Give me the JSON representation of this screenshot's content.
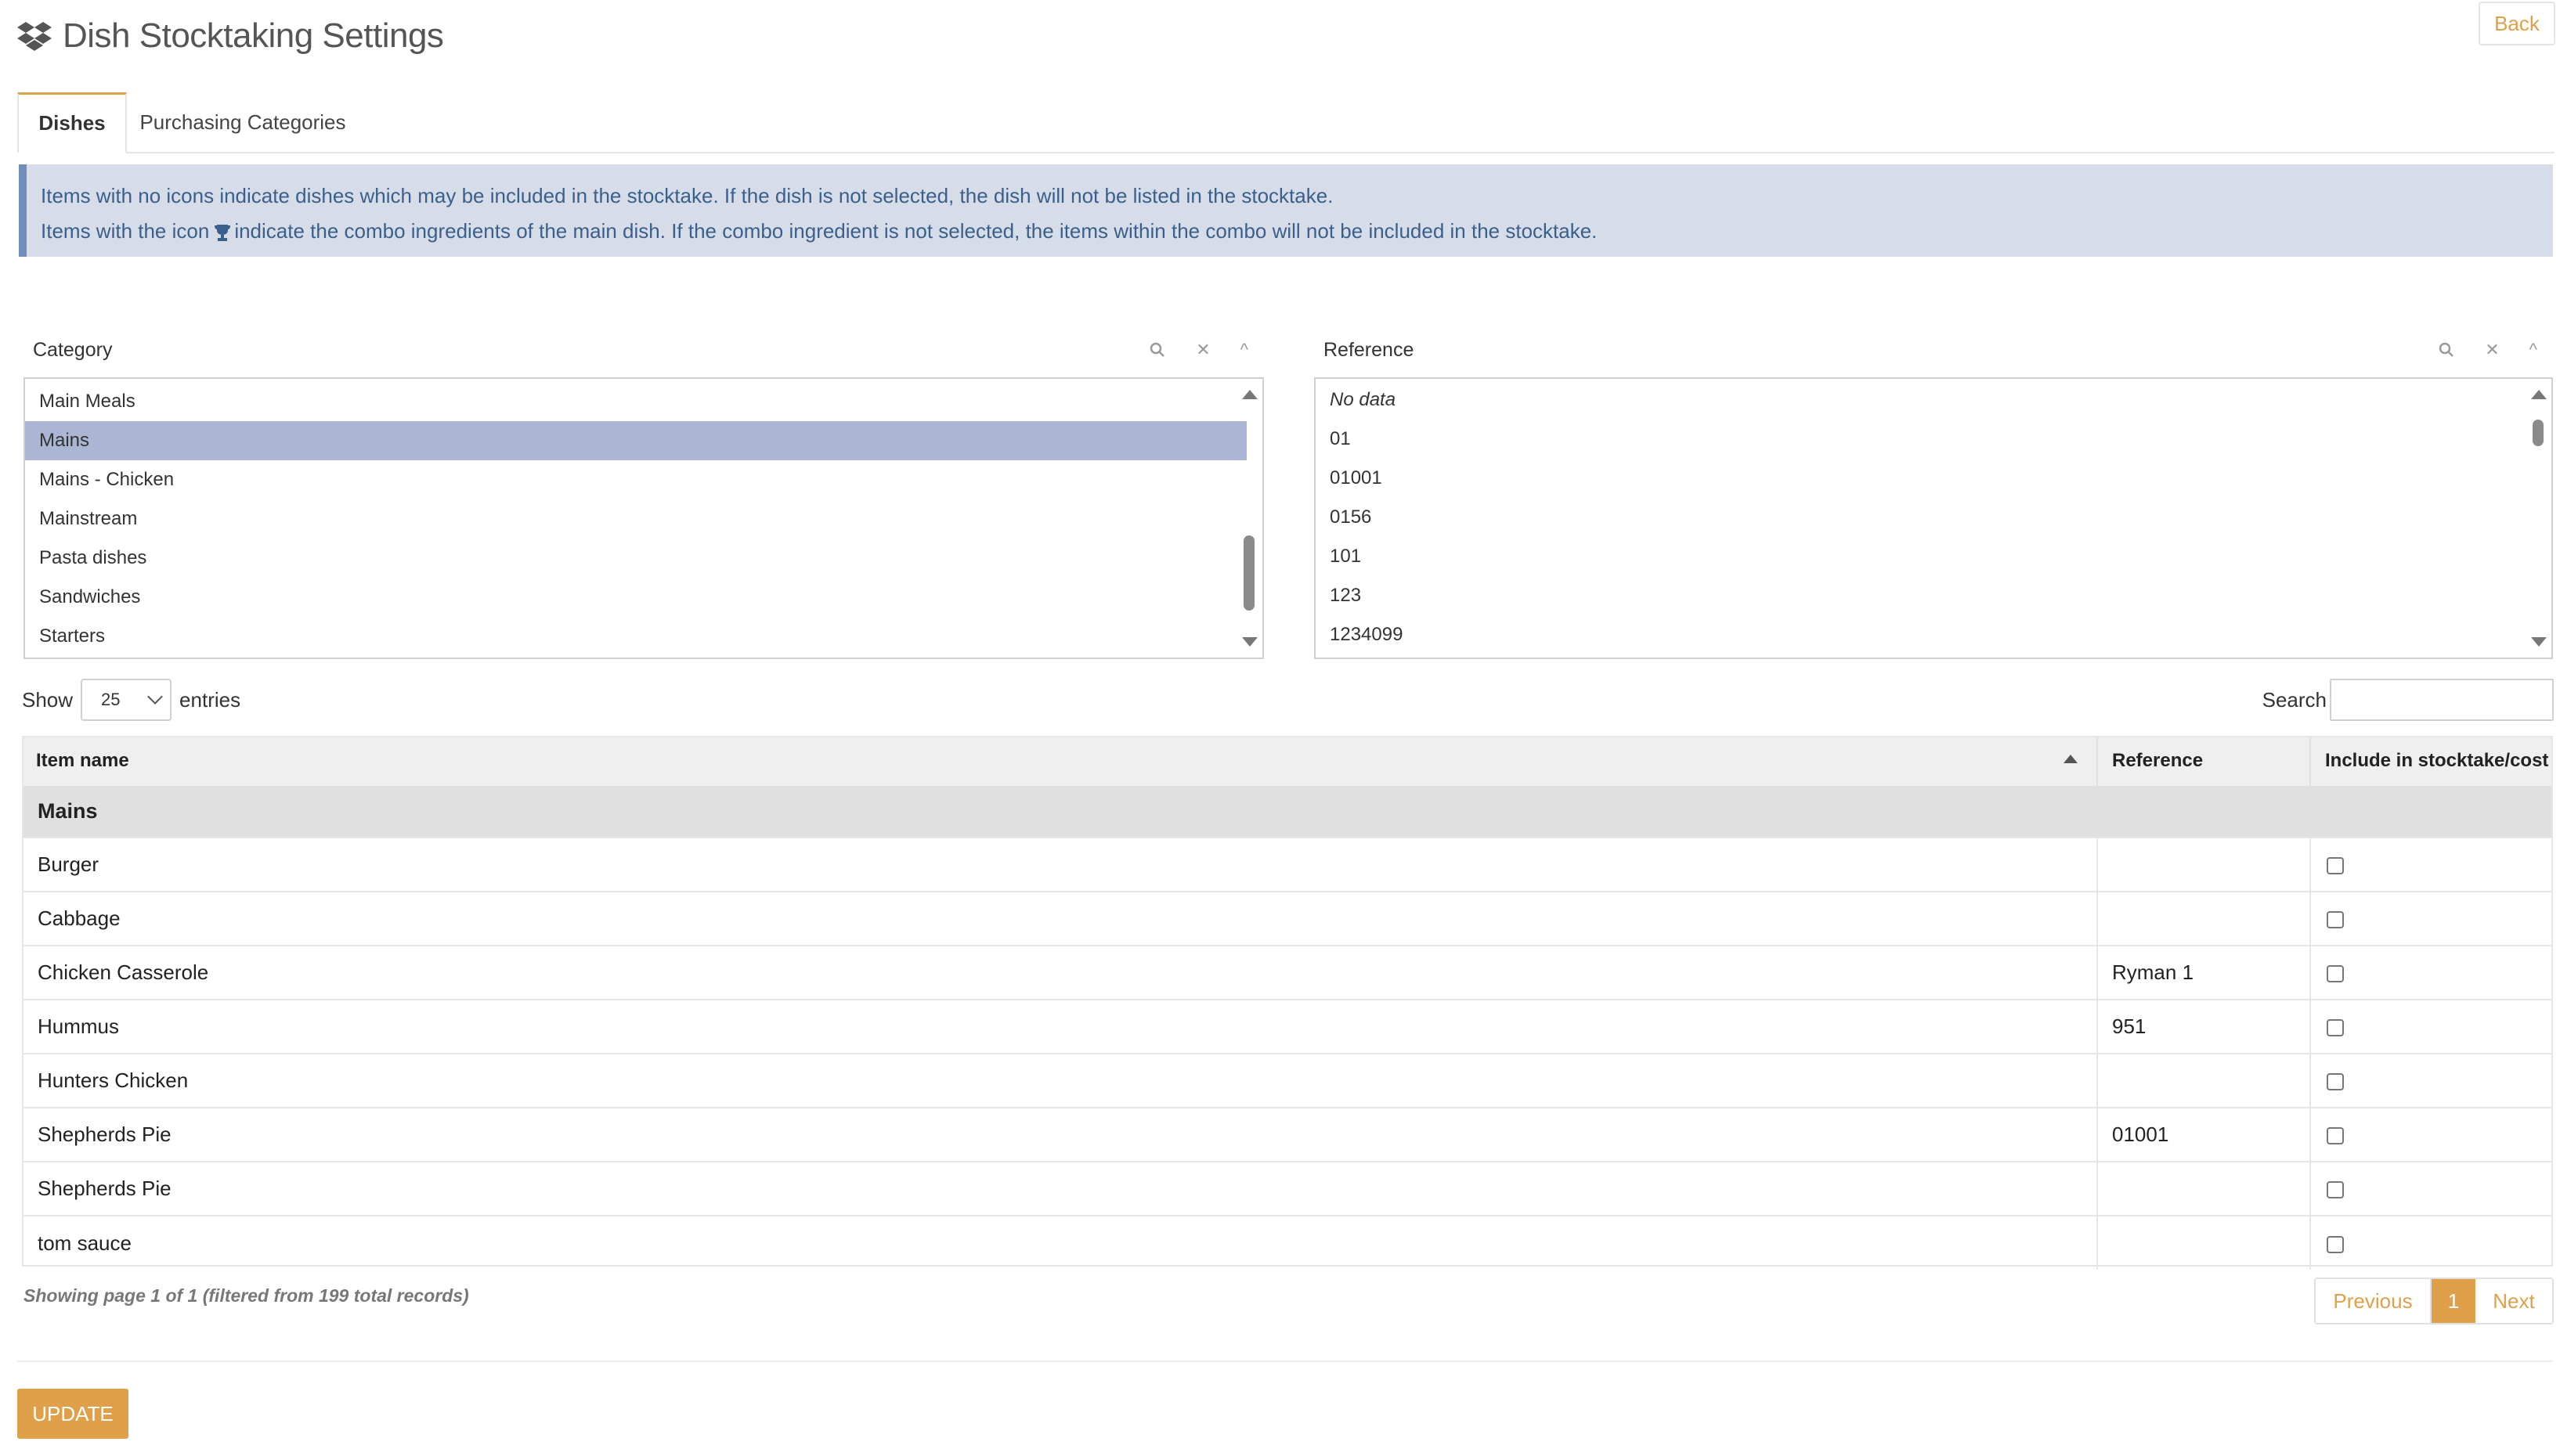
{
  "header": {
    "title": "Dish Stocktaking Settings",
    "back_label": "Back"
  },
  "tabs": [
    {
      "label": "Dishes",
      "active": true
    },
    {
      "label": "Purchasing Categories",
      "active": false
    }
  ],
  "info": {
    "line1": "Items with no icons indicate dishes which may be included in the stocktake. If the dish is not selected, the dish will not be listed in the stocktake.",
    "line2_before": "Items with the icon",
    "line2_after": "indicate the combo ingredients of the main dish. If the combo ingredient is not selected, the items within the combo will not be included in the stocktake.",
    "combo_icon": "trophy-icon"
  },
  "category_filter": {
    "label": "Category",
    "items": [
      "Main Meals",
      "Mains",
      "Mains - Chicken",
      "Mainstream",
      "Pasta dishes",
      "Sandwiches",
      "Starters"
    ],
    "selected": "Mains"
  },
  "reference_filter": {
    "label": "Reference",
    "items": [
      "No data",
      "01",
      "01001",
      "0156",
      "101",
      "123",
      "1234099"
    ]
  },
  "length_menu": {
    "show_label": "Show",
    "value": "25",
    "entries_label": "entries"
  },
  "search": {
    "label": "Search",
    "value": ""
  },
  "table": {
    "columns": [
      "Item name",
      "Reference",
      "Include in stocktake/cost"
    ],
    "group": "Mains",
    "rows": [
      {
        "name": "Burger",
        "reference": "",
        "checked": false
      },
      {
        "name": "Cabbage",
        "reference": "",
        "checked": false
      },
      {
        "name": "Chicken Casserole",
        "reference": "Ryman 1",
        "checked": false
      },
      {
        "name": "Hummus",
        "reference": "951",
        "checked": false
      },
      {
        "name": "Hunters Chicken",
        "reference": "",
        "checked": false
      },
      {
        "name": "Shepherds Pie",
        "reference": "01001",
        "checked": false
      },
      {
        "name": "Shepherds Pie",
        "reference": "",
        "checked": false
      },
      {
        "name": "tom sauce",
        "reference": "",
        "checked": false
      }
    ]
  },
  "status_text": "Showing page 1 of 1 (filtered from 199 total records)",
  "pagination": {
    "previous": "Previous",
    "current": "1",
    "next": "Next"
  },
  "update_label": "UPDATE",
  "colors": {
    "accent": "#e0a04a",
    "info_bg": "#d6dde8",
    "info_text": "#3a5f8c",
    "selected_item": "#aab6d4"
  }
}
